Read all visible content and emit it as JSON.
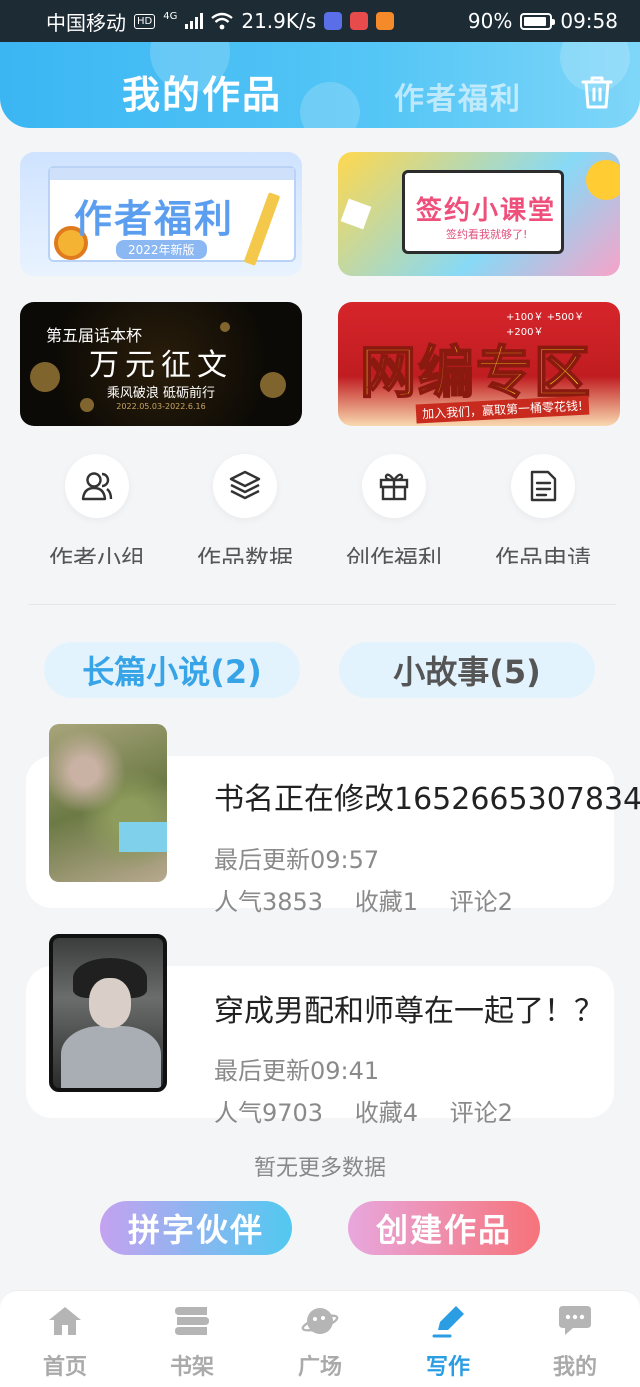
{
  "status_bar": {
    "carrier": "中国移动",
    "hd": "HD",
    "net": "4G",
    "speed": "21.9K/s",
    "battery": "90%",
    "battery_level": 0.9,
    "time": "09:58"
  },
  "header": {
    "title": "我的作品",
    "tab": "作者福利",
    "accent": "#3bb6f3"
  },
  "banners": [
    {
      "title": "作者福利",
      "subtitle": "2022年新版"
    },
    {
      "title": "签约小课堂",
      "subtitle": "签约看我就够了!"
    },
    {
      "line1": "第五届话本杯",
      "title": "万元征文",
      "subtitle": "乘风破浪 砥砺前行",
      "date": "2022.05.03-2022.6.16"
    },
    {
      "title": "网编专区",
      "subtitle": "加入我们，赢取第一桶零花钱!",
      "money": "+100￥  +500￥  +200￥"
    }
  ],
  "shortcuts": [
    {
      "label": "作者小组",
      "icon": "users-icon"
    },
    {
      "label": "作品数据",
      "icon": "layers-icon"
    },
    {
      "label": "创作福利",
      "icon": "gift-icon"
    },
    {
      "label": "作品申请",
      "icon": "document-icon"
    }
  ],
  "tabs": [
    {
      "label": "长篇小说(2)",
      "active": true
    },
    {
      "label": "小故事(5)",
      "active": false
    }
  ],
  "works": [
    {
      "title": "书名正在修改1652665307834",
      "updated": "最后更新09:57",
      "popularity": "人气3853",
      "favorites": "收藏1",
      "comments": "评论2"
    },
    {
      "title": "穿成男配和师尊在一起了！？",
      "updated": "最后更新09:41",
      "popularity": "人气9703",
      "favorites": "收藏4",
      "comments": "评论2"
    }
  ],
  "no_more": "暂无更多数据",
  "actions": {
    "partner": "拼字伙伴",
    "create": "创建作品"
  },
  "nav": [
    {
      "label": "首页",
      "icon": "home-icon"
    },
    {
      "label": "书架",
      "icon": "bookshelf-icon"
    },
    {
      "label": "广场",
      "icon": "planet-icon"
    },
    {
      "label": "写作",
      "icon": "pen-icon",
      "active": true
    },
    {
      "label": "我的",
      "icon": "chat-bubble-icon"
    }
  ],
  "colors": {
    "active_blue": "#2a9de3",
    "inactive_gray": "#aaaaaa"
  }
}
